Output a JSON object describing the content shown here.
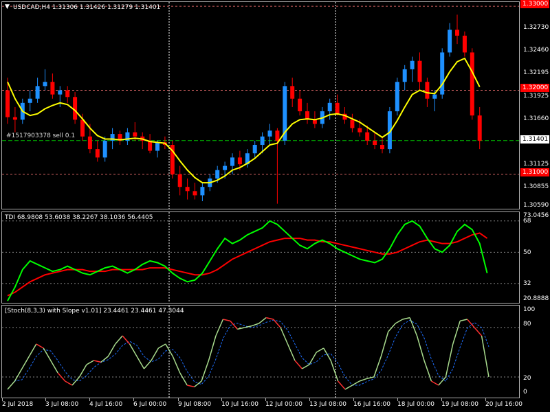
{
  "chart": {
    "symbol_info": "USDCAD,H4  1.31306 1.31426 1.31279 1.31401",
    "trade_label": "#1517903378 sell 0.1",
    "colors": {
      "background": "#000000",
      "bull": "#1e90ff",
      "bear": "#ff0000",
      "ma": "#ffff00",
      "tdi_fast": "#00ff00",
      "tdi_slow": "#ff0000",
      "stoch_main": "#a9dc8e",
      "stoch_signal": "#1e6fff",
      "stoch_slope": "#ff3030",
      "grid": "#ffffff",
      "level_line": "#d06060",
      "trade_line": "#00c000"
    }
  },
  "price_axis": {
    "ticks": [
      "1.33000",
      "1.32730",
      "1.32460",
      "1.32195",
      "1.31925",
      "1.31660",
      "1.31125",
      "1.30855",
      "1.30590"
    ],
    "tags": [
      {
        "label": "1.33000",
        "kind": "level"
      },
      {
        "label": "1.32000",
        "kind": "level"
      },
      {
        "label": "1.31401",
        "kind": "current"
      },
      {
        "label": "1.31000",
        "kind": "level"
      }
    ]
  },
  "tdi": {
    "label": "TDI 68.9808 53.6038 38.2267 38.1036 56.4405",
    "ticks": [
      "73.0456",
      "68",
      "50",
      "32",
      "20.8888"
    ]
  },
  "stoch": {
    "label": "[Stoch(8,3,3) with Slope v1.01] 23.4461 23.4461 47.3044",
    "ticks": [
      "100",
      "80",
      "20",
      "0"
    ]
  },
  "time_axis": {
    "labels": [
      "2 Jul 2018",
      "3 Jul 08:00",
      "4 Jul 16:00",
      "6 Jul 00:00",
      "9 Jul 08:00",
      "10 Jul 16:00",
      "12 Jul 00:00",
      "13 Jul 08:00",
      "16 Jul 16:00",
      "18 Jul 00:00",
      "19 Jul 08:00",
      "20 Jul 16:00"
    ]
  },
  "chart_data": {
    "type": "candlestick",
    "title": "USDCAD,H4",
    "ylim": [
      1.3059,
      1.3305
    ],
    "candles": [
      [
        1.32,
        1.3215,
        1.316,
        1.3168
      ],
      [
        1.3168,
        1.318,
        1.315,
        1.3165
      ],
      [
        1.3165,
        1.319,
        1.316,
        1.3185
      ],
      [
        1.3185,
        1.32,
        1.3175,
        1.319
      ],
      [
        1.319,
        1.3215,
        1.3185,
        1.3205
      ],
      [
        1.3205,
        1.3225,
        1.32,
        1.321
      ],
      [
        1.321,
        1.322,
        1.319,
        1.3195
      ],
      [
        1.3195,
        1.3205,
        1.318,
        1.32
      ],
      [
        1.32,
        1.3205,
        1.3185,
        1.3192
      ],
      [
        1.3192,
        1.3198,
        1.316,
        1.3165
      ],
      [
        1.3165,
        1.3172,
        1.314,
        1.3145
      ],
      [
        1.3145,
        1.316,
        1.3125,
        1.313
      ],
      [
        1.313,
        1.314,
        1.3115,
        1.312
      ],
      [
        1.312,
        1.3145,
        1.3115,
        1.314
      ],
      [
        1.314,
        1.3155,
        1.313,
        1.3148
      ],
      [
        1.3148,
        1.3152,
        1.3135,
        1.314
      ],
      [
        1.314,
        1.3155,
        1.3135,
        1.315
      ],
      [
        1.315,
        1.3162,
        1.314,
        1.3145
      ],
      [
        1.3145,
        1.315,
        1.313,
        1.314
      ],
      [
        1.314,
        1.3148,
        1.3125,
        1.3128
      ],
      [
        1.3128,
        1.314,
        1.312,
        1.3138
      ],
      [
        1.3138,
        1.3145,
        1.313,
        1.3135
      ],
      [
        1.3135,
        1.314,
        1.3095,
        1.31
      ],
      [
        1.31,
        1.311,
        1.3075,
        1.3085
      ],
      [
        1.3085,
        1.3095,
        1.307,
        1.308
      ],
      [
        1.308,
        1.309,
        1.307,
        1.3075
      ],
      [
        1.3075,
        1.309,
        1.3068,
        1.3085
      ],
      [
        1.3085,
        1.31,
        1.308,
        1.3095
      ],
      [
        1.3095,
        1.311,
        1.309,
        1.3105
      ],
      [
        1.3105,
        1.3115,
        1.3095,
        1.311
      ],
      [
        1.311,
        1.3125,
        1.31,
        1.312
      ],
      [
        1.312,
        1.3128,
        1.3105,
        1.3112
      ],
      [
        1.3112,
        1.313,
        1.3108,
        1.3125
      ],
      [
        1.3125,
        1.314,
        1.312,
        1.3135
      ],
      [
        1.3135,
        1.315,
        1.3125,
        1.3145
      ],
      [
        1.3145,
        1.316,
        1.3135,
        1.3152
      ],
      [
        1.3152,
        1.3155,
        1.3065,
        1.314
      ],
      [
        1.314,
        1.321,
        1.3135,
        1.3205
      ],
      [
        1.3205,
        1.3215,
        1.318,
        1.319
      ],
      [
        1.319,
        1.32,
        1.317,
        1.3175
      ],
      [
        1.3175,
        1.3185,
        1.316,
        1.3165
      ],
      [
        1.3165,
        1.3175,
        1.3155,
        1.316
      ],
      [
        1.316,
        1.318,
        1.3155,
        1.3175
      ],
      [
        1.3175,
        1.319,
        1.3165,
        1.3185
      ],
      [
        1.3185,
        1.3195,
        1.317,
        1.3172
      ],
      [
        1.3172,
        1.318,
        1.316,
        1.3165
      ],
      [
        1.3165,
        1.3172,
        1.315,
        1.3155
      ],
      [
        1.3155,
        1.3165,
        1.3145,
        1.315
      ],
      [
        1.315,
        1.3158,
        1.3135,
        1.314
      ],
      [
        1.314,
        1.315,
        1.313,
        1.3135
      ],
      [
        1.3135,
        1.3145,
        1.3125,
        1.313
      ],
      [
        1.313,
        1.318,
        1.3125,
        1.3175
      ],
      [
        1.3175,
        1.3215,
        1.317,
        1.321
      ],
      [
        1.321,
        1.323,
        1.32,
        1.3225
      ],
      [
        1.3225,
        1.324,
        1.321,
        1.3235
      ],
      [
        1.3235,
        1.3245,
        1.32,
        1.321
      ],
      [
        1.321,
        1.3215,
        1.318,
        1.319
      ],
      [
        1.319,
        1.32,
        1.3175,
        1.3195
      ],
      [
        1.3195,
        1.325,
        1.319,
        1.3245
      ],
      [
        1.3245,
        1.328,
        1.324,
        1.3272
      ],
      [
        1.3272,
        1.329,
        1.3255,
        1.3265
      ],
      [
        1.3265,
        1.327,
        1.324,
        1.3245
      ],
      [
        1.3245,
        1.325,
        1.3165,
        1.317
      ],
      [
        1.317,
        1.318,
        1.313,
        1.314
      ]
    ],
    "ma": [
      1.321,
      1.319,
      1.3175,
      1.317,
      1.3172,
      1.3178,
      1.3182,
      1.3185,
      1.3183,
      1.3176,
      1.3166,
      1.3155,
      1.3146,
      1.3142,
      1.3142,
      1.3141,
      1.3142,
      1.3143,
      1.3142,
      1.3139,
      1.3138,
      1.3137,
      1.3128,
      1.3116,
      1.3105,
      1.3096,
      1.309,
      1.309,
      1.3093,
      1.3098,
      1.3105,
      1.3108,
      1.3113,
      1.3119,
      1.3127,
      1.3135,
      1.3137,
      1.315,
      1.316,
      1.3165,
      1.3166,
      1.3165,
      1.3167,
      1.3171,
      1.3172,
      1.317,
      1.3166,
      1.3162,
      1.3156,
      1.315,
      1.3144,
      1.315,
      1.3164,
      1.318,
      1.3195,
      1.32,
      1.3197,
      1.3196,
      1.3207,
      1.3222,
      1.3234,
      1.3238,
      1.3222,
      1.3204
    ],
    "tdi_fast": [
      22,
      30,
      40,
      45,
      43,
      41,
      39,
      40,
      42,
      40,
      38,
      37,
      39,
      41,
      42,
      40,
      38,
      40,
      43,
      45,
      44,
      42,
      38,
      35,
      33,
      34,
      38,
      45,
      52,
      58,
      55,
      57,
      60,
      62,
      64,
      68,
      66,
      62,
      58,
      54,
      52,
      55,
      57,
      55,
      52,
      50,
      48,
      46,
      45,
      44,
      46,
      52,
      60,
      66,
      68,
      65,
      58,
      52,
      50,
      54,
      62,
      66,
      63,
      55,
      38
    ],
    "tdi_slow": [
      25,
      27,
      30,
      33,
      35,
      37,
      38,
      39,
      40,
      40,
      40,
      39,
      39,
      39,
      40,
      40,
      40,
      40,
      40,
      41,
      41,
      41,
      40,
      39,
      38,
      37,
      37,
      38,
      40,
      43,
      46,
      48,
      50,
      52,
      54,
      56,
      57,
      58,
      58,
      58,
      57,
      57,
      56,
      56,
      55,
      54,
      53,
      52,
      51,
      50,
      49,
      49,
      50,
      52,
      54,
      56,
      57,
      56,
      55,
      55,
      56,
      58,
      60,
      61,
      58
    ],
    "stoch_main": [
      5,
      15,
      30,
      45,
      60,
      55,
      40,
      25,
      15,
      10,
      20,
      35,
      40,
      38,
      45,
      60,
      70,
      60,
      45,
      30,
      40,
      55,
      60,
      45,
      25,
      10,
      8,
      15,
      40,
      70,
      90,
      88,
      78,
      80,
      82,
      85,
      92,
      90,
      80,
      60,
      40,
      30,
      35,
      50,
      55,
      40,
      15,
      5,
      10,
      15,
      18,
      20,
      45,
      75,
      85,
      90,
      92,
      70,
      40,
      15,
      10,
      20,
      60,
      88,
      90,
      80,
      70,
      20
    ]
  }
}
